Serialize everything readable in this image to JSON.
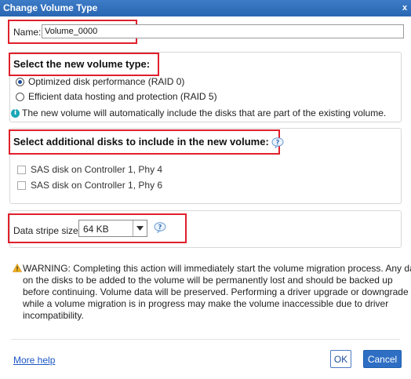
{
  "window": {
    "title": "Change Volume Type",
    "close_glyph": "x"
  },
  "name_field": {
    "label": "Name:",
    "value": "Volume_0000"
  },
  "volume_type": {
    "title": "Select the new volume type:",
    "options": [
      {
        "label": "Optimized disk performance (RAID 0)",
        "selected": true
      },
      {
        "label": "Efficient data hosting and protection (RAID 5)",
        "selected": false
      }
    ],
    "info_text": "The new volume will automatically include the disks that are part of the existing volume."
  },
  "additional_disks": {
    "title": "Select additional disks to include in the new volume:",
    "disks": [
      {
        "label": "SAS disk on Controller 1, Phy 4",
        "checked": false
      },
      {
        "label": "SAS disk on Controller 1, Phy 6",
        "checked": false
      }
    ]
  },
  "stripe": {
    "label": "Data stripe size:",
    "value": "64 KB"
  },
  "warning": {
    "lines": [
      "WARNING: Completing this action will immediately start the volume migration process. Any data",
      "on the disks to be added to the volume will be permanently lost and should be backed up",
      "before continuing. Volume data will be preserved. Performing a driver upgrade or downgrade",
      "while a volume migration is in progress may make the volume inaccessible due to driver",
      "incompatibility."
    ]
  },
  "footer": {
    "more_help": "More help",
    "ok": "OK",
    "cancel": "Cancel"
  },
  "colors": {
    "titlebar": "#2a66b2",
    "highlight_border": "#e0202c",
    "link": "#1a56c4",
    "primary_button": "#2e6fc4",
    "info_icon": "#1aa6b7"
  }
}
